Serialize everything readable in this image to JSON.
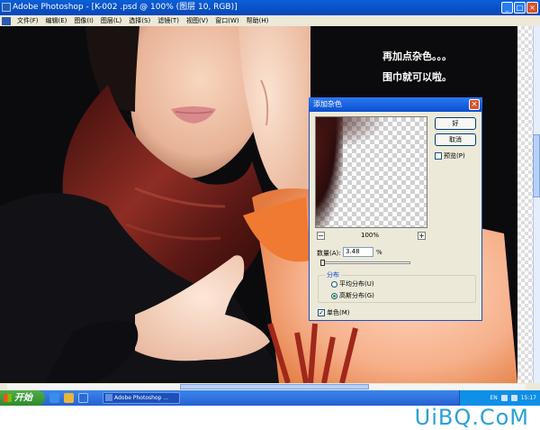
{
  "window": {
    "title": "Adobe Photoshop - [K-002 .psd @ 100% (图层 10, RGB)]",
    "minimize": "_",
    "maximize": "□",
    "close": "×"
  },
  "menu": [
    "文件(F)",
    "编辑(E)",
    "图像(I)",
    "图层(L)",
    "选择(S)",
    "滤镜(T)",
    "视图(V)",
    "窗口(W)",
    "帮助(H)"
  ],
  "notes": {
    "line1": "再加点杂色。。。",
    "line2": "围巾就可以啦。"
  },
  "dialog": {
    "title": "添加杂色",
    "close": "×",
    "ok": "好",
    "cancel": "取消",
    "preview_label": "预览(P)",
    "preview_checked": "",
    "zoom_out": "−",
    "zoom_in": "+",
    "zoom": "100%",
    "amount_label": "数量(A):",
    "amount_value": "3.48",
    "amount_unit": "%",
    "distribution_label": "分布",
    "uniform_label": "平均分布(U)",
    "gaussian_label": "高斯分布(G)",
    "mono_label": "单色(M)",
    "mono_checked": "✓"
  },
  "taskbar": {
    "start": "开始",
    "task_label": "Adobe Photoshop ...",
    "clock": "15:17",
    "lang": "EN"
  },
  "watermark": "UiBQ.CoM",
  "colors": {
    "xp_blue": "#0a5fd8",
    "scarf_red": "#8a2a22",
    "skin": "#f7cdb2",
    "watermark": "#2aa0d8"
  }
}
